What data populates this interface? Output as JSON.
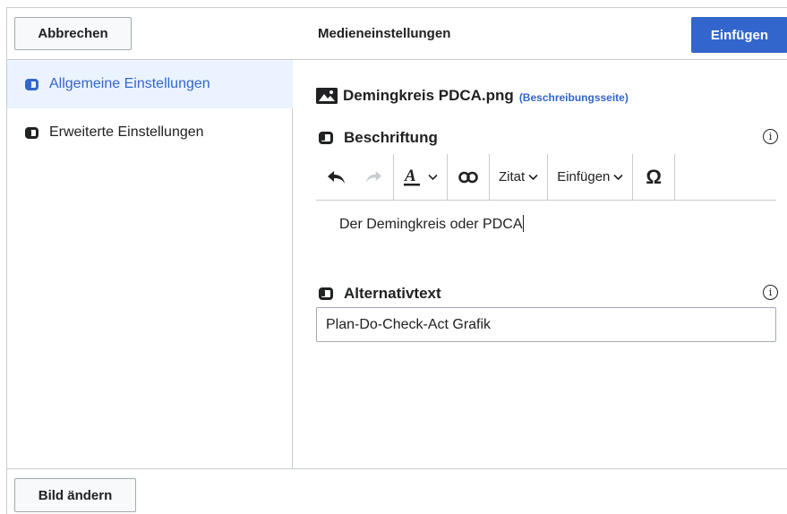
{
  "header": {
    "cancel_label": "Abbrechen",
    "title": "Medieneinstellungen",
    "insert_label": "Einfügen"
  },
  "sidebar": {
    "items": [
      {
        "label": "Allgemeine Einstellungen",
        "active": true
      },
      {
        "label": "Erweiterte Einstellungen",
        "active": false
      }
    ]
  },
  "main": {
    "filename": "Demingkreis PDCA.png",
    "description_link": "(Beschreibungsseite)",
    "caption_label": "Beschriftung",
    "caption_text": "Der Demingkreis oder PDCA",
    "alt_label": "Alternativtext",
    "alt_value": "Plan-Do-Check-Act Grafik"
  },
  "toolbar": {
    "cite_label": "Zitat",
    "insert_label": "Einfügen",
    "special_char": "Ω"
  },
  "footer": {
    "change_label": "Bild ändern"
  },
  "colors": {
    "accent": "#3366cc",
    "active_bg": "#eaf3ff",
    "border": "#c8ccd1"
  }
}
